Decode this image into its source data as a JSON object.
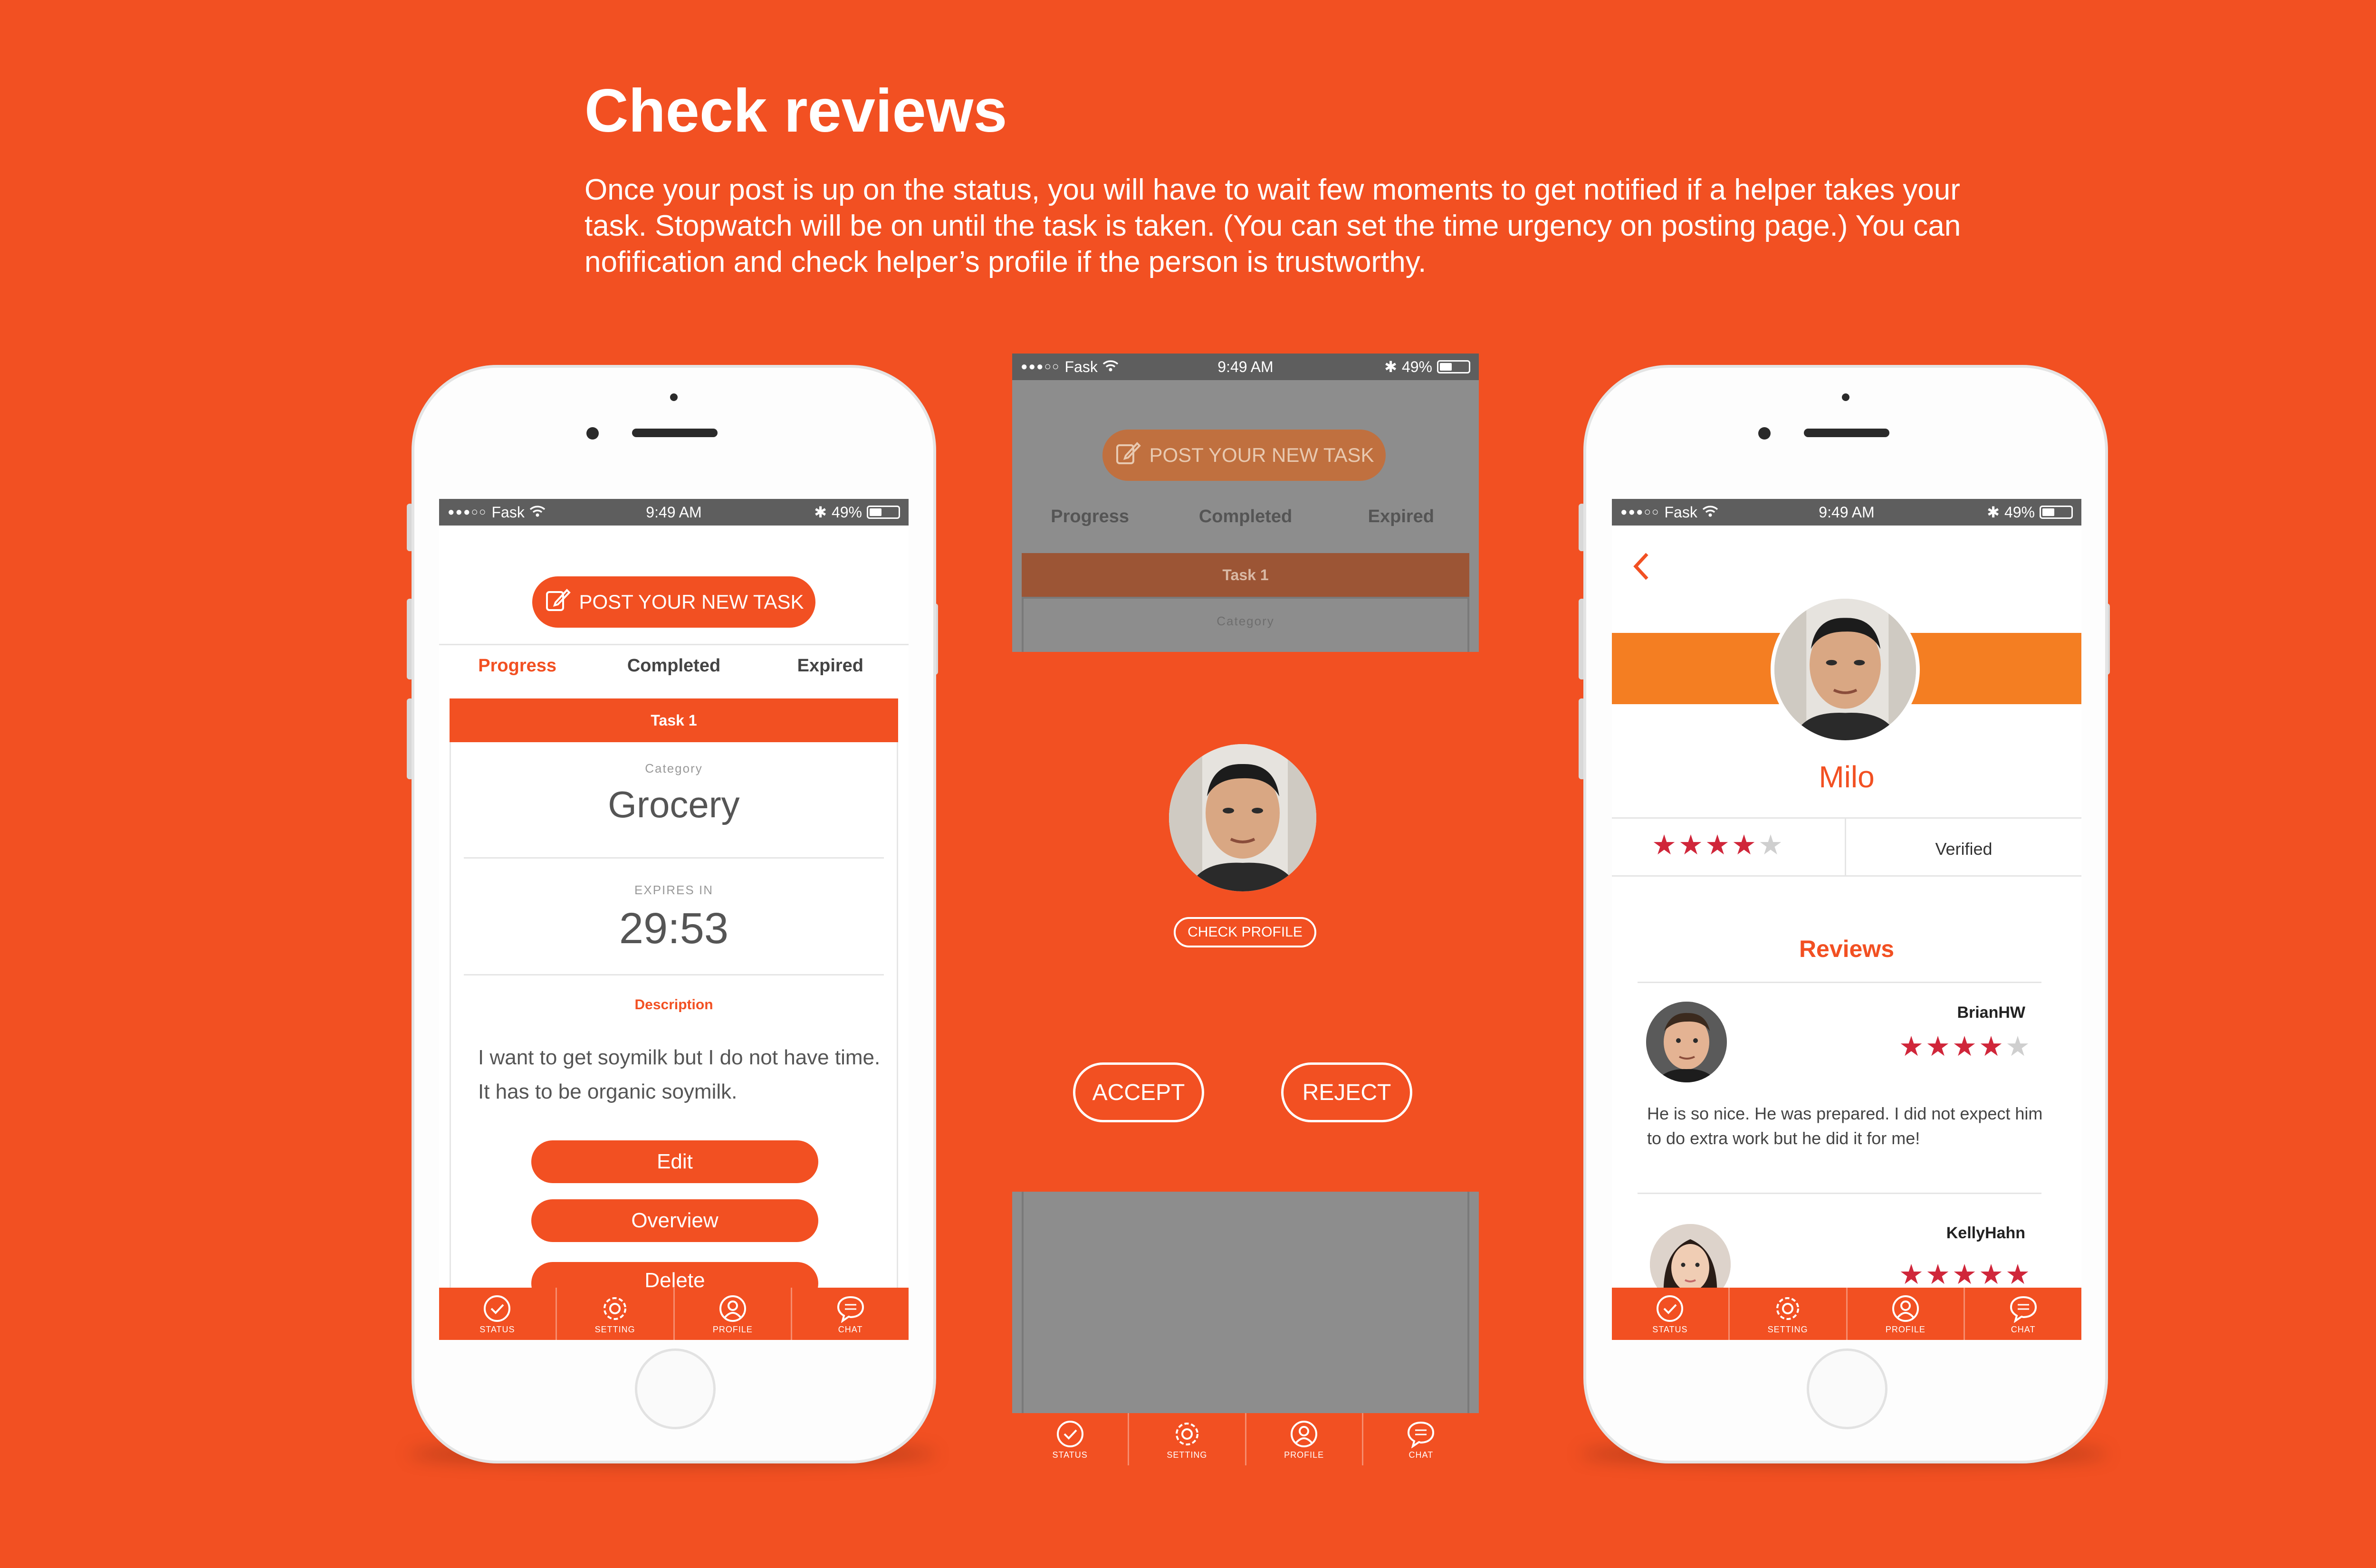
{
  "page": {
    "heading": "Check reviews",
    "intro": "Once your post is up on the status, you will have to wait few moments to get notified if a helper takes your task. Stopwatch will be on until the task is taken. (You can set the time urgency on posting page.) You can nofification and check helper’s profile if the person is trustworthy."
  },
  "colors": {
    "brand": "#F25022",
    "dim": "#8d8d8d",
    "profile_band": "#F47E22",
    "star_filled": "#D0263A",
    "star_empty": "#cfcfcf"
  },
  "status_bar": {
    "carrier": "Fask",
    "time": "9:49 AM",
    "battery": "49%",
    "battery_level": 0.49
  },
  "post_button": {
    "label": "POST YOUR NEW TASK",
    "icon": "edit-icon"
  },
  "tabs": {
    "progress": "Progress",
    "completed": "Completed",
    "expired": "Expired"
  },
  "task": {
    "title": "Task 1",
    "category_label": "Category",
    "category": "Grocery",
    "expires_label": "EXPIRES IN",
    "expires_value": "29:53",
    "description_label": "Description",
    "description": "I want to get soymilk but I do not have time. It has to be organic soymilk.",
    "buttons": {
      "edit": "Edit",
      "overview": "Overview",
      "delete": "Delete"
    }
  },
  "tabbar": {
    "status": "STATUS",
    "setting": "SETTING",
    "profile": "PROFILE",
    "chat": "CHAT"
  },
  "notification": {
    "check_profile": "CHECK PROFILE",
    "accept": "ACCEPT",
    "reject": "REJECT"
  },
  "profile": {
    "name": "Milo",
    "rating": 4,
    "verified": "Verified",
    "reviews_title": "Reviews",
    "reviews": [
      {
        "author": "BrianHW",
        "rating": 4,
        "text": "He is so nice. He was prepared. I did not expect him to do extra work but he did it for me!"
      },
      {
        "author": "KellyHahn",
        "rating": 5,
        "text": ""
      }
    ]
  }
}
